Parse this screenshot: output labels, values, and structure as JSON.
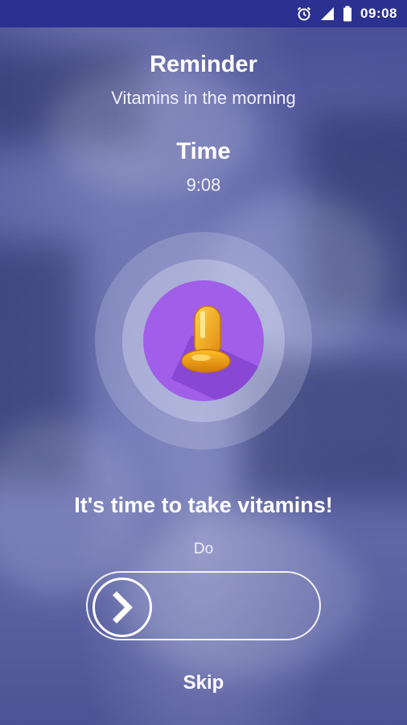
{
  "status_bar": {
    "time": "09:08",
    "icons": [
      "alarm-icon",
      "signal-icon",
      "battery-icon"
    ]
  },
  "reminder": {
    "heading": "Reminder",
    "name": "Vitamins in the morning"
  },
  "time_section": {
    "heading": "Time",
    "value": "9:08"
  },
  "alert": {
    "icon": "vitamin-capsule-icon",
    "message": "It's time to take vitamins!"
  },
  "action": {
    "label": "Do",
    "slider_icon": "chevron-right-icon"
  },
  "skip_label": "Skip",
  "colors": {
    "status_bar": "#2b3190",
    "overlay": "#4a4f95",
    "accent_purple": "#a15ee8",
    "capsule_gold": "#f3b21a",
    "text": "#ffffff"
  }
}
